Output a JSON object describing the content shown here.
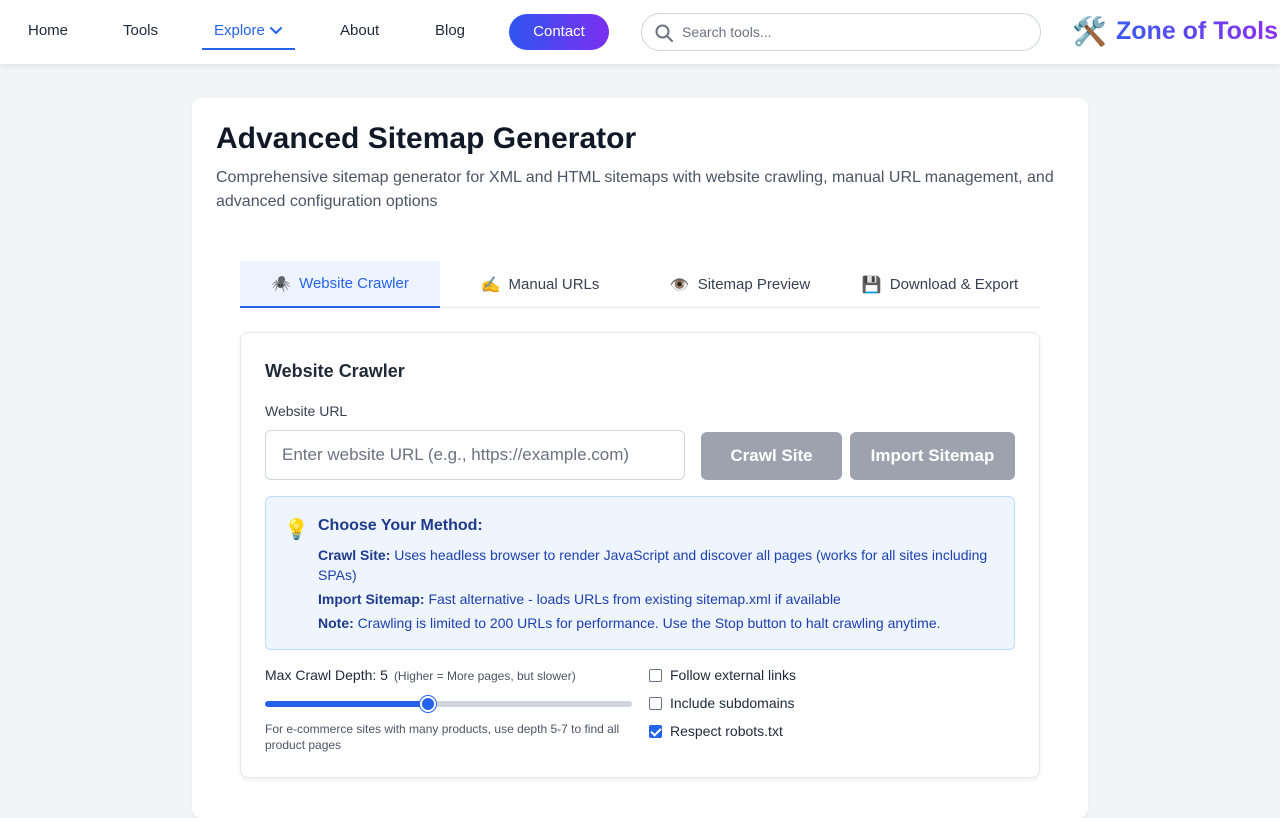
{
  "nav": {
    "items": [
      {
        "label": "Home"
      },
      {
        "label": "Tools"
      },
      {
        "label": "Explore"
      },
      {
        "label": "About"
      },
      {
        "label": "Blog"
      }
    ],
    "contact_label": "Contact",
    "search_placeholder": "Search tools...",
    "logo_icon": "🛠️",
    "logo_text": "Zone of Tools"
  },
  "page": {
    "title": "Advanced Sitemap Generator",
    "description": "Comprehensive sitemap generator for XML and HTML sitemaps with website crawling, manual URL management, and advanced configuration options"
  },
  "tabs": [
    {
      "icon": "🕷️",
      "label": "Website Crawler",
      "active": true
    },
    {
      "icon": "✍️",
      "label": "Manual URLs",
      "active": false
    },
    {
      "icon": "👁️",
      "label": "Sitemap Preview",
      "active": false
    },
    {
      "icon": "💾",
      "label": "Download & Export",
      "active": false
    }
  ],
  "crawler": {
    "title": "Website Crawler",
    "url_label": "Website URL",
    "url_placeholder": "Enter website URL (e.g., https://example.com)",
    "crawl_button": "Crawl Site",
    "import_button": "Import Sitemap",
    "info": {
      "icon": "💡",
      "title": "Choose Your Method:",
      "crawl_label": "Crawl Site:",
      "crawl_text": " Uses headless browser to render JavaScript and discover all pages (works for all sites including SPAs)",
      "import_label": "Import Sitemap:",
      "import_text": " Fast alternative - loads URLs from existing sitemap.xml if available",
      "note_label": "Note:",
      "note_text": " Crawling is limited to 200 URLs for performance. Use the Stop button to halt crawling anytime."
    },
    "depth": {
      "label": "Max Crawl Depth: 5",
      "hint": "(Higher = More pages, but slower)",
      "value": 5,
      "min": 1,
      "max": 10,
      "note": "For e-commerce sites with many products, use depth 5-7 to find all product pages"
    },
    "options": [
      {
        "label": "Follow external links",
        "checked": false
      },
      {
        "label": "Include subdomains",
        "checked": false
      },
      {
        "label": "Respect robots.txt",
        "checked": true
      }
    ]
  },
  "colors": {
    "accent": "#2563eb",
    "brand_start": "#3b5bf0",
    "brand_end": "#8b2ff0",
    "button_disabled": "#9ca3af"
  }
}
